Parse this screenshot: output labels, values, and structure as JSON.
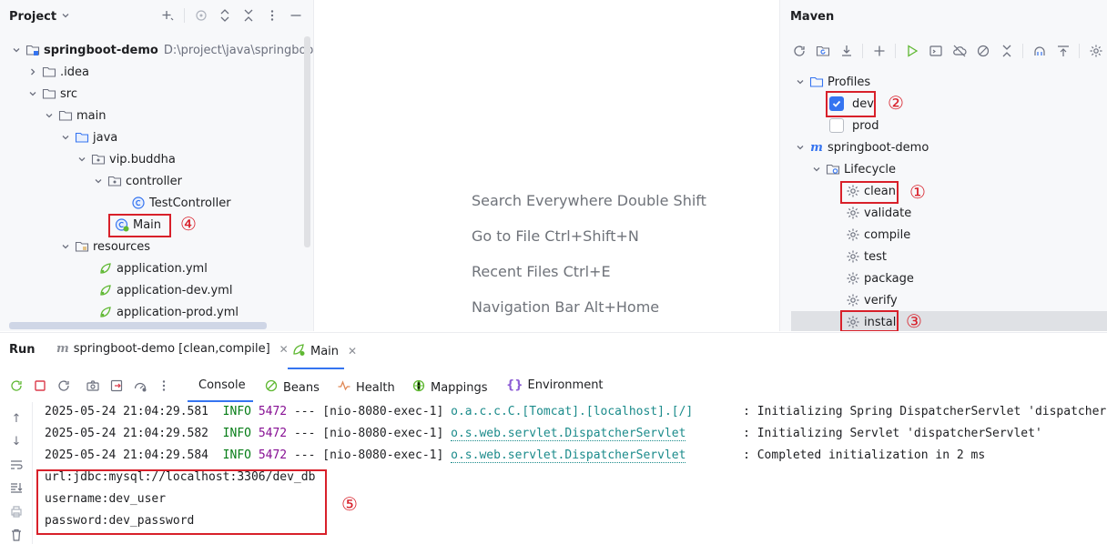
{
  "project": {
    "title": "Project",
    "tree": [
      {
        "label": "springboot-demo",
        "path": "D:\\project\\java\\springboot-der"
      },
      {
        "label": ".idea"
      },
      {
        "label": "src"
      },
      {
        "label": "main"
      },
      {
        "label": "java"
      },
      {
        "label": "vip.buddha"
      },
      {
        "label": "controller"
      },
      {
        "label": "TestController"
      },
      {
        "label": "Main"
      },
      {
        "label": "resources"
      },
      {
        "label": "application.yml"
      },
      {
        "label": "application-dev.yml"
      },
      {
        "label": "application-prod.yml"
      }
    ],
    "annotation": "④"
  },
  "editor": {
    "hints": [
      "Search Everywhere Double Shift",
      "Go to File Ctrl+Shift+N",
      "Recent Files Ctrl+E",
      "Navigation Bar Alt+Home"
    ]
  },
  "maven": {
    "title": "Maven",
    "profiles_label": "Profiles",
    "profiles": [
      {
        "label": "dev",
        "checked": true
      },
      {
        "label": "prod",
        "checked": false
      }
    ],
    "project_label": "springboot-demo",
    "lifecycle_label": "Lifecycle",
    "phases": [
      "clean",
      "validate",
      "compile",
      "test",
      "package",
      "verify",
      "install"
    ],
    "annotations": {
      "dev": "②",
      "clean": "①",
      "install": "③"
    }
  },
  "run": {
    "title": "Run",
    "tabs": [
      {
        "label": "springboot-demo [clean,compile]"
      },
      {
        "label": "Main"
      }
    ],
    "console_tabs": [
      "Console",
      "Beans",
      "Health",
      "Mappings",
      "Environment"
    ],
    "log_lines": [
      {
        "ts": "2025-05-24 21:04:29.581",
        "level": "INFO",
        "pid": "5472",
        "sep": "---",
        "thread": "[nio-8080-exec-1]",
        "logger": "o.a.c.c.C.[Tomcat].[localhost].[/]",
        "msg": ": Initializing Spring DispatcherServlet 'dispatcherServlet'"
      },
      {
        "ts": "2025-05-24 21:04:29.582",
        "level": "INFO",
        "pid": "5472",
        "sep": "---",
        "thread": "[nio-8080-exec-1]",
        "logger": "o.s.web.servlet.DispatcherServlet",
        "msg": ": Initializing Servlet 'dispatcherServlet'"
      },
      {
        "ts": "2025-05-24 21:04:29.584",
        "level": "INFO",
        "pid": "5472",
        "sep": "---",
        "thread": "[nio-8080-exec-1]",
        "logger": "o.s.web.servlet.DispatcherServlet",
        "msg": ": Completed initialization in 2 ms"
      }
    ],
    "output": [
      "url:jdbc:mysql://localhost:3306/dev_db",
      "username:dev_user",
      "password:dev_password"
    ],
    "annotation": "⑤"
  },
  "colors": {
    "accent": "#3574f0",
    "annotation_red": "#d8202a",
    "info_green": "#067d17",
    "pid_purple": "#871094",
    "logger_teal": "#1b8b8b"
  }
}
